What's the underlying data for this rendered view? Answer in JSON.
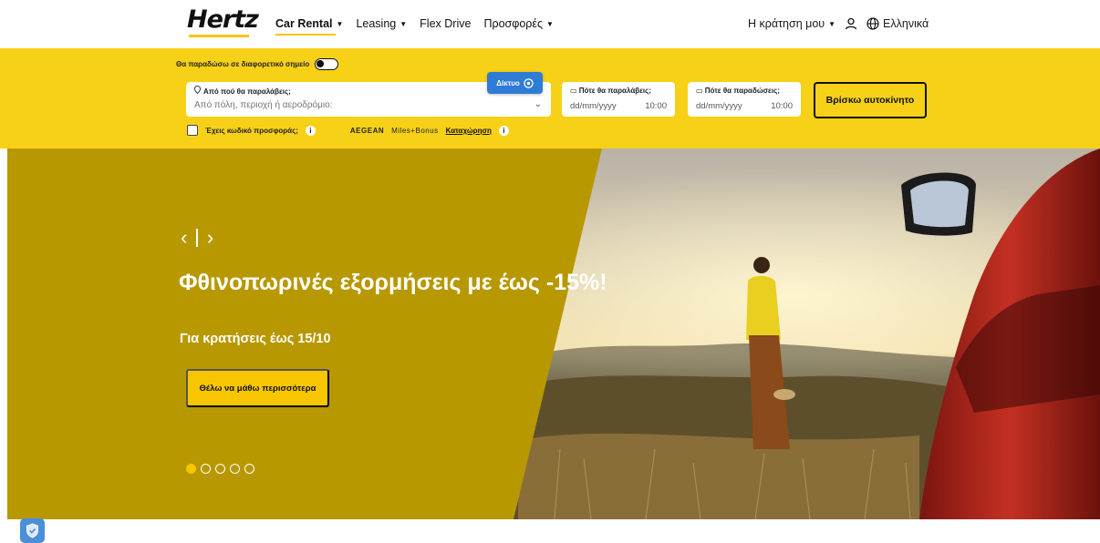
{
  "brand": {
    "logo_text": "Hertz",
    "accent": "#f7c600"
  },
  "nav": {
    "items": [
      {
        "label": "Car Rental",
        "active": true,
        "has_dropdown": true
      },
      {
        "label": "Leasing",
        "active": false,
        "has_dropdown": true
      },
      {
        "label": "Flex Drive",
        "active": false,
        "has_dropdown": false
      },
      {
        "label": "Προσφορές",
        "active": false,
        "has_dropdown": true
      }
    ],
    "my_booking": "Η κράτηση μου",
    "user_icon": "user-icon",
    "language_icon": "globe-icon",
    "language": "Ελληνικά"
  },
  "search": {
    "deliver_elsewhere_label": "Θα παραδώσω σε διαφορετικό σημείο",
    "deliver_elsewhere_on": false,
    "pickup_label": "Από πού θα παραλάβεις;",
    "pickup_placeholder": "Από πόλη, περιοχή ή αεροδρόμιο:",
    "network_button": "Δίκτυο",
    "pickup_date_label": "Πότε θα παραλάβεις;",
    "pickup_date_placeholder": "dd/mm/yyyy",
    "pickup_time": "10:00",
    "return_date_label": "Πότε θα παραδώσεις;",
    "return_date_placeholder": "dd/mm/yyyy",
    "return_time": "10:00",
    "find_button": "Βρίσκω αυτοκίνητο",
    "promo_code_label": "Έχεις κωδικό προσφοράς;",
    "aegean_text": "AEGEAN",
    "miles_text": "Miles+Bonus",
    "register_link": "Καταχώρηση"
  },
  "hero": {
    "title": "Φθινοπωρινές εξορμήσεις με έως -15%!",
    "subtitle": "Για κρατήσεις έως 15/10",
    "cta": "Θέλω να μάθω περισσότερα",
    "slide_count": 5,
    "active_slide": 1,
    "prev_icon": "chevron-left-icon",
    "next_icon": "chevron-right-icon"
  },
  "privacy_icon": "shield-check-icon"
}
